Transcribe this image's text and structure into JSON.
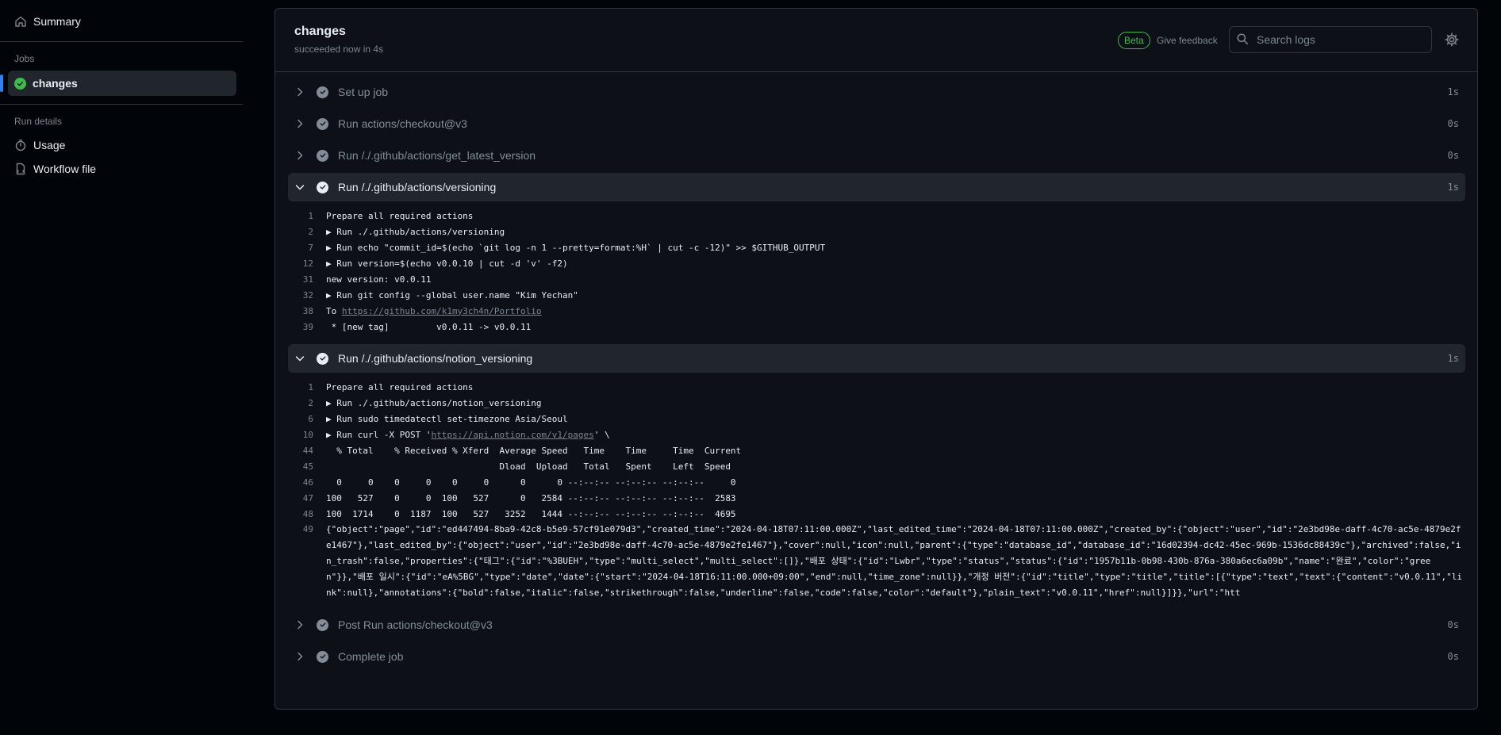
{
  "sidebar": {
    "summary": "Summary",
    "jobs_heading": "Jobs",
    "active_job": "changes",
    "run_details_heading": "Run details",
    "usage": "Usage",
    "workflow_file": "Workflow file"
  },
  "header": {
    "title": "changes",
    "subtitle": "succeeded now in 4s",
    "beta": "Beta",
    "feedback": "Give feedback",
    "search_placeholder": "Search logs"
  },
  "steps": [
    {
      "name": "Set up job",
      "duration": "1s"
    },
    {
      "name": "Run actions/checkout@v3",
      "duration": "0s"
    },
    {
      "name": "Run /./.github/actions/get_latest_version",
      "duration": "0s"
    },
    {
      "name": "Run /./.github/actions/versioning",
      "duration": "1s"
    },
    {
      "name": "Run /./.github/actions/notion_versioning",
      "duration": "1s"
    },
    {
      "name": "Post Run actions/checkout@v3",
      "duration": "0s"
    },
    {
      "name": "Complete job",
      "duration": "0s"
    }
  ],
  "versioning_log": [
    {
      "n": "1",
      "t": "Prepare all required actions"
    },
    {
      "n": "2",
      "t": "▶ Run ./.github/actions/versioning"
    },
    {
      "n": "7",
      "t": "▶ Run echo \"commit_id=$(echo `git log -n 1 --pretty=format:%H` | cut -c -12)\" >> $GITHUB_OUTPUT"
    },
    {
      "n": "12",
      "t": "▶ Run version=$(echo v0.0.10 | cut -d 'v' -f2)"
    },
    {
      "n": "31",
      "t": "new version: v0.0.11"
    },
    {
      "n": "32",
      "t": "▶ Run git config --global user.name \"Kim Yechan\""
    },
    {
      "n": "38",
      "t": "To ",
      "link": "https://github.com/k1my3ch4n/Portfolio"
    },
    {
      "n": "39",
      "t": " * [new tag]         v0.0.11 -> v0.0.11"
    }
  ],
  "notion_log": [
    {
      "n": "1",
      "t": "Prepare all required actions"
    },
    {
      "n": "2",
      "t": "▶ Run ./.github/actions/notion_versioning"
    },
    {
      "n": "6",
      "t": "▶ Run sudo timedatectl set-timezone Asia/Seoul"
    },
    {
      "n": "10",
      "t": "▶ Run curl -X POST '",
      "link": "https://api.notion.com/v1/pages",
      "after": "' \\"
    },
    {
      "n": "44",
      "t": "  % Total    % Received % Xferd  Average Speed   Time    Time     Time  Current"
    },
    {
      "n": "45",
      "t": "                                 Dload  Upload   Total   Spent    Left  Speed"
    },
    {
      "n": "46",
      "t": "  0     0    0     0    0     0      0      0 --:--:-- --:--:-- --:--:--     0"
    },
    {
      "n": "47",
      "t": "100   527    0     0  100   527      0   2584 --:--:-- --:--:-- --:--:--  2583"
    },
    {
      "n": "48",
      "t": "100  1714    0  1187  100   527   3252   1444 --:--:-- --:--:-- --:--:--  4695"
    },
    {
      "n": "49",
      "wrap": true,
      "t": "{\"object\":\"page\",\"id\":\"ed447494-8ba9-42c8-b5e9-57cf91e079d3\",\"created_time\":\"2024-04-18T07:11:00.000Z\",\"last_edited_time\":\"2024-04-18T07:11:00.000Z\",\"created_by\":{\"object\":\"user\",\"id\":\"2e3bd98e-daff-4c70-ac5e-4879e2fe1467\"},\"last_edited_by\":{\"object\":\"user\",\"id\":\"2e3bd98e-daff-4c70-ac5e-4879e2fe1467\"},\"cover\":null,\"icon\":null,\"parent\":{\"type\":\"database_id\",\"database_id\":\"16d02394-dc42-45ec-969b-1536dc88439c\"},\"archived\":false,\"in_trash\":false,\"properties\":{\"태그\":{\"id\":\"%3BUEH\",\"type\":\"multi_select\",\"multi_select\":[]},\"배포 상태\":{\"id\":\"Lwbr\",\"type\":\"status\",\"status\":{\"id\":\"1957b11b-0b98-430b-876a-380a6ec6a09b\",\"name\":\"완료\",\"color\":\"green\"}},\"배포 일시\":{\"id\":\"eA%5BG\",\"type\":\"date\",\"date\":{\"start\":\"2024-04-18T16:11:00.000+09:00\",\"end\":null,\"time_zone\":null}},\"개정 버전\":{\"id\":\"title\",\"type\":\"title\",\"title\":[{\"type\":\"text\",\"text\":{\"content\":\"v0.0.11\",\"link\":null},\"annotations\":{\"bold\":false,\"italic\":false,\"strikethrough\":false,\"underline\":false,\"code\":false,\"color\":\"default\"},\"plain_text\":\"v0.0.11\",\"href\":null}]}},\"url\":\"htt"
    }
  ]
}
